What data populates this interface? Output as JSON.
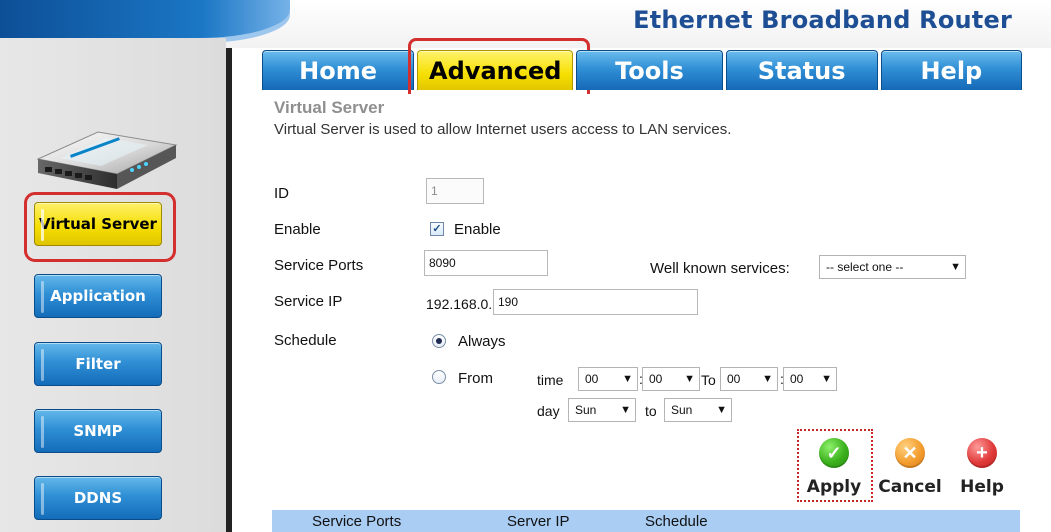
{
  "header": {
    "title": "Ethernet Broadband Router"
  },
  "tabs": [
    {
      "label": "Home"
    },
    {
      "label": "Advanced"
    },
    {
      "label": "Tools"
    },
    {
      "label": "Status"
    },
    {
      "label": "Help"
    }
  ],
  "sidebar": {
    "items": [
      {
        "label": "Virtual Server"
      },
      {
        "label": "Application"
      },
      {
        "label": "Filter"
      },
      {
        "label": "SNMP"
      },
      {
        "label": "DDNS"
      }
    ]
  },
  "page": {
    "title": "Virtual Server",
    "description": "Virtual Server is used to allow Internet users access to LAN services."
  },
  "form": {
    "id_label": "ID",
    "id_value": "1",
    "enable_label": "Enable",
    "enable_checkbox_label": "Enable",
    "service_ports_label": "Service Ports",
    "service_ports_value": "8090",
    "well_known_label": "Well known services:",
    "well_known_value": "-- select one --",
    "service_ip_label": "Service IP",
    "service_ip_prefix": "192.168.0.",
    "service_ip_value": "190",
    "schedule_label": "Schedule",
    "always_label": "Always",
    "from_label": "From",
    "time_label": "time",
    "to_time_label": "To",
    "day_label": "day",
    "to_day_label": "to",
    "time_values": [
      "00",
      "00",
      "00",
      "00"
    ],
    "day_values": [
      "Sun",
      "Sun"
    ],
    "time_separator": ":"
  },
  "actions": {
    "apply": "Apply",
    "cancel": "Cancel",
    "help": "Help"
  },
  "table": {
    "headers": [
      "Service Ports",
      "Server IP",
      "Schedule"
    ]
  },
  "icons": {
    "check": "✓",
    "select_arrow": "▼",
    "apply": "✓",
    "cancel": "✕",
    "help": "+"
  }
}
